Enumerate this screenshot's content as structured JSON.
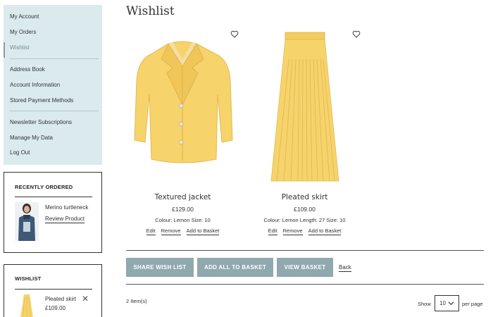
{
  "sidebar": {
    "items": [
      {
        "label": "My Account"
      },
      {
        "label": "My Orders"
      },
      {
        "label": "Wishlist"
      },
      {
        "label": "Address Book"
      },
      {
        "label": "Account Information"
      },
      {
        "label": "Stored Payment Methods"
      },
      {
        "label": "Newsletter Subscriptions"
      },
      {
        "label": "Manage My Data"
      },
      {
        "label": "Log Out"
      }
    ],
    "active_index": 2
  },
  "recently_ordered": {
    "title": "RECENTLY ORDERED",
    "product": "Merino turtleneck",
    "link": "Review Product"
  },
  "wishlist_box": {
    "title": "WISHLIST",
    "product": "Pleated skirt",
    "price": "£109.00"
  },
  "page": {
    "title": "Wishlist"
  },
  "products": [
    {
      "name": "Textured jacket",
      "price": "£129.00",
      "attrs": "Colour: Lemon Size: 10",
      "actions": [
        "Edit",
        "Remove",
        "Add to Basket"
      ]
    },
    {
      "name": "Pleated skirt",
      "price": "£109.00",
      "attrs": "Colour: Lemon Length: 27 Size: 10",
      "actions": [
        "Edit",
        "Remove",
        "Add to Basket"
      ]
    }
  ],
  "buttons": {
    "share": "SHARE WISH LIST",
    "add_all": "ADD ALL TO BASKET",
    "view": "VIEW BASKET",
    "back": "Back"
  },
  "toolbar": {
    "count": "2 Item(s)",
    "show": "Show",
    "per_page_value": "10",
    "per_page": "per page"
  },
  "colors": {
    "nav_bg": "#dbeaed",
    "button_bg": "#8fa9ae",
    "product_yellow": "#f6d36b"
  }
}
